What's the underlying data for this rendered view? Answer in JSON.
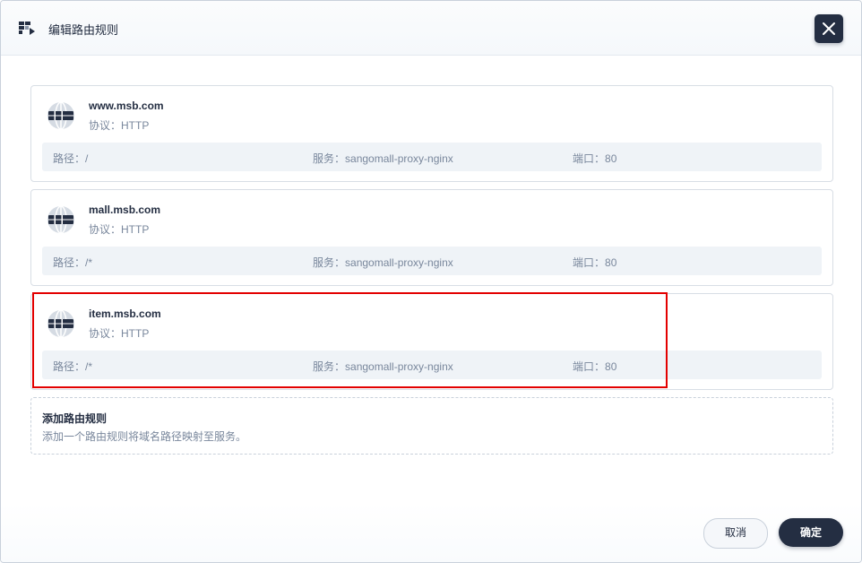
{
  "dialog": {
    "title": "编辑路由规则",
    "close_icon": "close-icon",
    "header_icon": "route-icon"
  },
  "rules": [
    {
      "host": "www.msb.com",
      "protocol_label": "协议：",
      "protocol": "HTTP",
      "path_label": "路径：",
      "path": "/",
      "service_label": "服务：",
      "service": "sangomall-proxy-nginx",
      "port_label": "端口：",
      "port": "80"
    },
    {
      "host": "mall.msb.com",
      "protocol_label": "协议：",
      "protocol": "HTTP",
      "path_label": "路径：",
      "path": "/*",
      "service_label": "服务：",
      "service": "sangomall-proxy-nginx",
      "port_label": "端口：",
      "port": "80"
    },
    {
      "host": "item.msb.com",
      "protocol_label": "协议：",
      "protocol": "HTTP",
      "path_label": "路径：",
      "path": "/*",
      "service_label": "服务：",
      "service": "sangomall-proxy-nginx",
      "port_label": "端口：",
      "port": "80"
    }
  ],
  "add_rule": {
    "title": "添加路由规则",
    "description": "添加一个路由规则将域名路径映射至服务。"
  },
  "footer": {
    "cancel_label": "取消",
    "ok_label": "确定"
  },
  "colors": {
    "primary_dark": "#242e42",
    "muted_text": "#79879c",
    "info_bar_bg": "#eff3f7",
    "highlight": "#e30000"
  }
}
